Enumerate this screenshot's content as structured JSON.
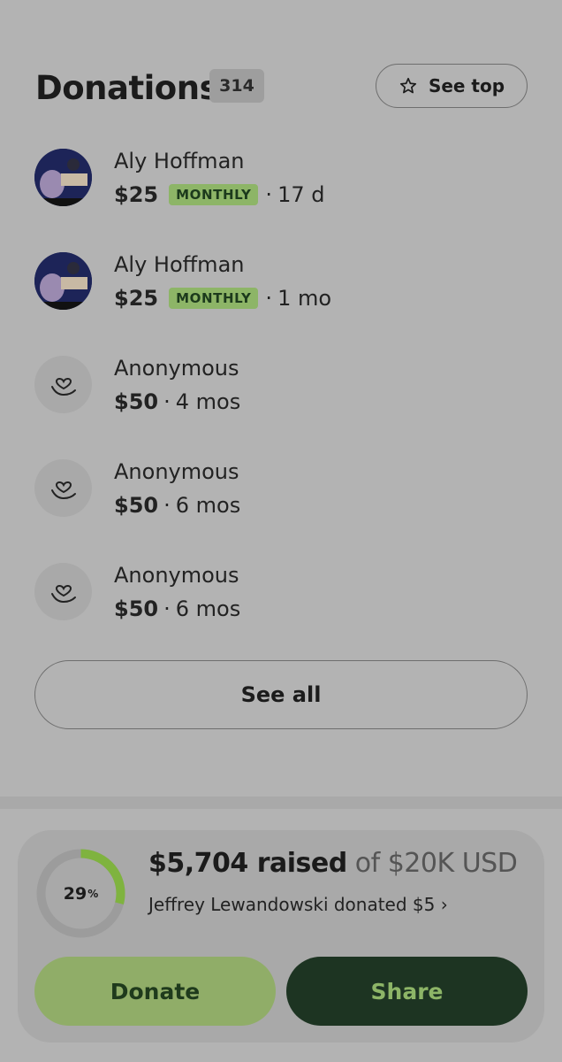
{
  "header": {
    "title": "Donations",
    "count": "314",
    "see_top_label": "See top"
  },
  "donations": [
    {
      "name": "Aly Hoffman",
      "amount": "$25",
      "badge": "MONTHLY",
      "sep": "·",
      "time": "17 d",
      "avatar": "photo"
    },
    {
      "name": "Aly Hoffman",
      "amount": "$25",
      "badge": "MONTHLY",
      "sep": "·",
      "time": "1 mo",
      "avatar": "photo"
    },
    {
      "name": "Anonymous",
      "amount": "$50",
      "badge": "",
      "sep": "·",
      "time": "4 mos",
      "avatar": "hand-heart-icon"
    },
    {
      "name": "Anonymous",
      "amount": "$50",
      "badge": "",
      "sep": "·",
      "time": "6 mos",
      "avatar": "hand-heart-icon"
    },
    {
      "name": "Anonymous",
      "amount": "$50",
      "badge": "",
      "sep": "·",
      "time": "6 mos",
      "avatar": "hand-heart-icon"
    }
  ],
  "see_all_label": "See all",
  "footer": {
    "progress_percent": 29,
    "progress_label": "29",
    "percent_sign": "%",
    "raised": "$5,704 raised",
    "goal": "of $20K USD",
    "recent_donation": "Jeffrey Lewandowski donated $5 ›",
    "donate_label": "Donate",
    "share_label": "Share"
  },
  "colors": {
    "badge_bg": "#8db567",
    "progress": "#7fb33f",
    "donate_bg": "#90ad68",
    "share_bg": "#1d3422"
  }
}
